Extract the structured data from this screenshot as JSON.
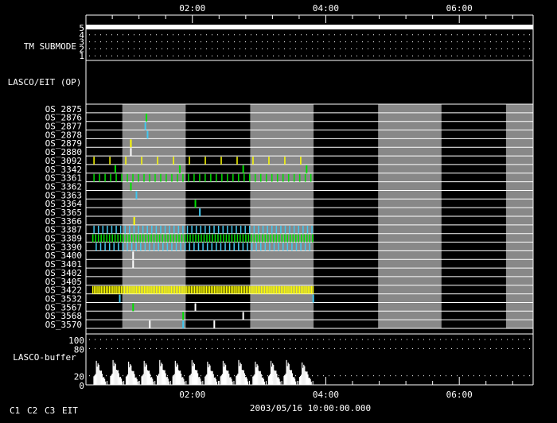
{
  "chart_data": {
    "type": "timeline",
    "x_range": [
      "00:24",
      "07:06"
    ],
    "time_ticks": [
      "02:00",
      "04:00",
      "06:00"
    ],
    "xlabel": "2003/05/16 10:00:00.000",
    "legend": [
      {
        "label": "C1",
        "color": "#ff2020"
      },
      {
        "label": "C2",
        "color": "#20ff20"
      },
      {
        "label": "C3",
        "color": "#80e0ff"
      },
      {
        "label": "EIT",
        "color": "#ffff20"
      }
    ],
    "colors": {
      "C1": "#ff2020",
      "C2": "#00e000",
      "C3": "#40c8f0",
      "EIT": "#ffff00",
      "other": "#ffffff",
      "band": "#888888"
    },
    "shaded_intervals": [
      [
        "00:57",
        "01:54"
      ],
      [
        "02:52",
        "03:49"
      ],
      [
        "04:47",
        "05:44"
      ],
      [
        "06:42",
        "07:06"
      ]
    ],
    "tm_submode": {
      "label": "TM SUBMODE",
      "levels": [
        "1",
        "2",
        "3",
        "4",
        "5"
      ],
      "value": 5
    },
    "op_panel": {
      "label": "LASCO/EIT (OP)"
    },
    "os_rows": [
      {
        "label": "OS_2875",
        "marks": []
      },
      {
        "label": "OS_2876",
        "marks": [
          {
            "t": "01:18",
            "c": "C2"
          }
        ]
      },
      {
        "label": "OS_2877",
        "marks": [
          {
            "t": "01:17",
            "c": "C3"
          }
        ]
      },
      {
        "label": "OS_2878",
        "marks": [
          {
            "t": "01:19",
            "c": "C3"
          }
        ]
      },
      {
        "label": "OS_2879",
        "marks": [
          {
            "t": "01:04",
            "c": "EIT"
          }
        ]
      },
      {
        "label": "OS_2880",
        "marks": [
          {
            "t": "01:04",
            "c": "other"
          }
        ]
      },
      {
        "label": "OS_3092",
        "repeat": {
          "from": "00:31",
          "to": "03:37",
          "every_min": 14.3,
          "c": "EIT"
        }
      },
      {
        "label": "OS_3342",
        "marks": [
          {
            "t": "00:50",
            "c": "C2"
          },
          {
            "t": "01:48",
            "c": "C2"
          },
          {
            "t": "02:45",
            "c": "C2"
          },
          {
            "t": "03:42",
            "c": "C2"
          }
        ]
      },
      {
        "label": "OS_3361",
        "repeat": {
          "from": "00:31",
          "to": "03:49",
          "every_min": 5,
          "c": "C2"
        }
      },
      {
        "label": "OS_3362",
        "marks": [
          {
            "t": "01:04",
            "c": "C2"
          }
        ]
      },
      {
        "label": "OS_3363",
        "marks": [
          {
            "t": "01:09",
            "c": "C3"
          }
        ]
      },
      {
        "label": "OS_3364",
        "marks": [
          {
            "t": "02:02",
            "c": "C2"
          }
        ]
      },
      {
        "label": "OS_3365",
        "marks": [
          {
            "t": "02:06",
            "c": "C3"
          }
        ]
      },
      {
        "label": "OS_3366",
        "marks": [
          {
            "t": "01:07",
            "c": "EIT"
          }
        ]
      },
      {
        "label": "OS_3387",
        "repeat": {
          "from": "00:31",
          "to": "03:49",
          "every_min": 4,
          "c": "C3"
        }
      },
      {
        "label": "OS_3389",
        "repeat": {
          "from": "00:30",
          "to": "03:49",
          "every_min": 2.5,
          "c": "C2"
        }
      },
      {
        "label": "OS_3390",
        "repeat": {
          "from": "00:33",
          "to": "03:47",
          "every_min": 4,
          "c": "C3"
        }
      },
      {
        "label": "OS_3400",
        "marks": [
          {
            "t": "01:06",
            "c": "other"
          }
        ]
      },
      {
        "label": "OS_3401",
        "marks": [
          {
            "t": "01:06",
            "c": "other"
          }
        ]
      },
      {
        "label": "OS_3402",
        "marks": []
      },
      {
        "label": "OS_3405",
        "marks": []
      },
      {
        "label": "OS_3422",
        "repeat": {
          "from": "00:30",
          "to": "03:49",
          "every_min": 1.5,
          "c": "EIT"
        }
      },
      {
        "label": "OS_3532",
        "marks": [
          {
            "t": "00:54",
            "c": "C3"
          },
          {
            "t": "03:48",
            "c": "C3"
          }
        ]
      },
      {
        "label": "OS_3567",
        "marks": [
          {
            "t": "01:06",
            "c": "C2"
          },
          {
            "t": "02:02",
            "c": "other"
          }
        ]
      },
      {
        "label": "OS_3568",
        "marks": [
          {
            "t": "01:51",
            "c": "C2"
          },
          {
            "t": "02:45",
            "c": "other"
          }
        ]
      },
      {
        "label": "OS_3570",
        "marks": [
          {
            "t": "01:21",
            "c": "other"
          },
          {
            "t": "01:51",
            "c": "C3"
          },
          {
            "t": "02:19",
            "c": "other"
          }
        ]
      }
    ],
    "buffer": {
      "label": "LASCO-buffer",
      "ylim": [
        0,
        100
      ],
      "y_ticks": [
        "0",
        "20",
        "80",
        "100"
      ],
      "peaks": [
        {
          "t": "00:33",
          "v": 60
        },
        {
          "t": "00:48",
          "v": 62
        },
        {
          "t": "01:02",
          "v": 58
        },
        {
          "t": "01:16",
          "v": 60
        },
        {
          "t": "01:30",
          "v": 62
        },
        {
          "t": "01:44",
          "v": 60
        },
        {
          "t": "01:59",
          "v": 62
        },
        {
          "t": "02:13",
          "v": 58
        },
        {
          "t": "02:27",
          "v": 60
        },
        {
          "t": "02:41",
          "v": 62
        },
        {
          "t": "02:56",
          "v": 58
        },
        {
          "t": "03:10",
          "v": 60
        },
        {
          "t": "03:24",
          "v": 62
        },
        {
          "t": "03:38",
          "v": 56
        }
      ]
    }
  }
}
